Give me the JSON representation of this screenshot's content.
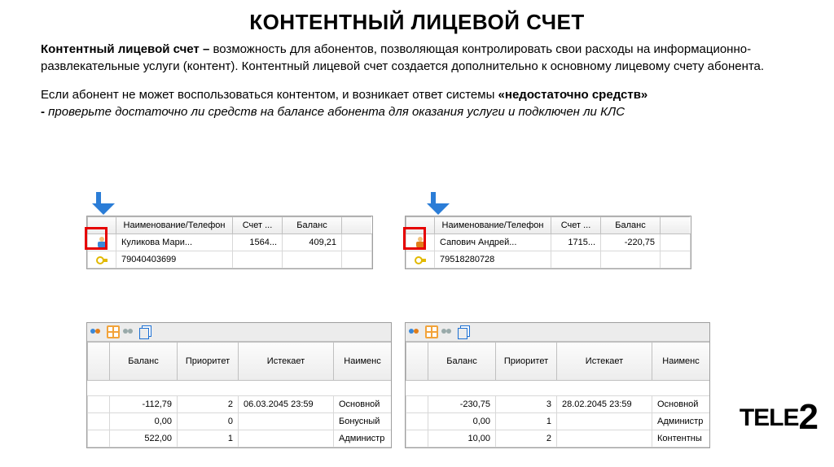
{
  "title": "КОНТЕНТНЫЙ ЛИЦЕВОЙ СЧЕТ",
  "intro": {
    "bold_lead": "Контентный лицевой счет –",
    "para1": " возможность для абонентов, позволяющая контролировать свои расходы на информационно-развлекательные услуги (контент). Контентный лицевой счет создается дополнительно к основному лицевому счету абонента.",
    "para2a": "Если абонент не может воспользоваться контентом, и возникает ответ системы ",
    "para2b_bold": "«недостаточно средств»",
    "para2c_bold": "- ",
    "para2c_italic": "проверьте достаточно ли средств на балансе абонента для оказания услуги и подключен ли КЛС"
  },
  "accountTable": {
    "headers": {
      "name": "Наименование/Телефон",
      "account": "Счет ...",
      "balance": "Баланс"
    }
  },
  "left": {
    "person": "Куликова Мари...",
    "phone": "79040403699",
    "account": "1564...",
    "balance": "409,21"
  },
  "right": {
    "person": "Сапович Андрей...",
    "phone": "79518280728",
    "account": "1715...",
    "balance": "-220,75"
  },
  "balanceTable": {
    "headers": {
      "balance": "Баланс",
      "priority": "Приоритет",
      "expires": "Истекает",
      "name": "Наименс"
    }
  },
  "leftBalances": [
    {
      "balance": "-112,79",
      "priority": "2",
      "expires": "06.03.2045 23:59",
      "name": "Основной"
    },
    {
      "balance": "0,00",
      "priority": "0",
      "expires": "",
      "name": "Бонусный"
    },
    {
      "balance": "522,00",
      "priority": "1",
      "expires": "",
      "name": "Администр"
    }
  ],
  "rightBalances": [
    {
      "balance": "-230,75",
      "priority": "3",
      "expires": "28.02.2045 23:59",
      "name": "Основной"
    },
    {
      "balance": "0,00",
      "priority": "1",
      "expires": "",
      "name": "Администр"
    },
    {
      "balance": "10,00",
      "priority": "2",
      "expires": "",
      "name": "Контентны"
    }
  ],
  "logo": {
    "text": "TELE",
    "two": "2"
  }
}
